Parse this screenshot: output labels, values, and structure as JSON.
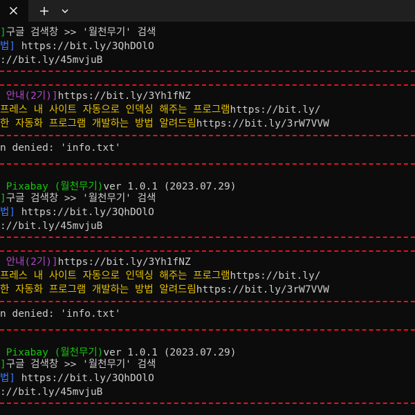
{
  "colors": {
    "background": "#0c0c0c",
    "titlebar": "#202020",
    "separator": "#e81123",
    "green": "#16c60c",
    "blue": "#3b78ff",
    "purple": "#b148c6",
    "yellow": "#e5c000",
    "text": "#cccccc"
  },
  "titlebar": {
    "icons": [
      "close-icon",
      "plus-icon",
      "chevron-down-icon"
    ]
  },
  "blocks": [
    {
      "l1": {
        "a": "]",
        "b": "구글 검색창 >> '월천무기' 검색"
      },
      "l2": {
        "a": "법]",
        "b": " https://bit.ly/3QhDOlO"
      },
      "l3": {
        "a": "://bit.ly/45mvjuB"
      },
      "l4": {
        "a": " 안내(2기)]",
        "b": "https://bit.ly/3Yh1fNZ"
      },
      "l5": {
        "a": "프레스 내 사이트 자동으로 인덱싱 해주는 프로그램",
        "b": "https://bit.ly/"
      },
      "l6": {
        "a": "한 자동화 프로그램 개발하는 방법 알려드림",
        "b": "https://bit.ly/3rW7VVW"
      },
      "l7": {
        "a": "n denied: 'info.txt'"
      },
      "l8": {
        "a": " Pixabay (월천무기)",
        "b": "ver 1.0.1 (2023.07.29)"
      }
    },
    {
      "l1": {
        "a": "]",
        "b": "구글 검색창 >> '월천무기' 검색"
      },
      "l2": {
        "a": "법]",
        "b": " https://bit.ly/3QhDOlO"
      },
      "l3": {
        "a": "://bit.ly/45mvjuB"
      },
      "l4": {
        "a": " 안내(2기)]",
        "b": "https://bit.ly/3Yh1fNZ"
      },
      "l5": {
        "a": "프레스 내 사이트 자동으로 인덱싱 해주는 프로그램",
        "b": "https://bit.ly/"
      },
      "l6": {
        "a": "한 자동화 프로그램 개발하는 방법 알려드림",
        "b": "https://bit.ly/3rW7VVW"
      },
      "l7": {
        "a": "n denied: 'info.txt'"
      },
      "l8": {
        "a": " Pixabay (월천무기)",
        "b": "ver 1.0.1 (2023.07.29)"
      }
    },
    {
      "l1": {
        "a": "]",
        "b": "구글 검색창 >> '월천무기' 검색"
      },
      "l2": {
        "a": "법]",
        "b": " https://bit.ly/3QhDOlO"
      },
      "l3": {
        "a": "://bit.ly/45mvjuB"
      }
    }
  ]
}
